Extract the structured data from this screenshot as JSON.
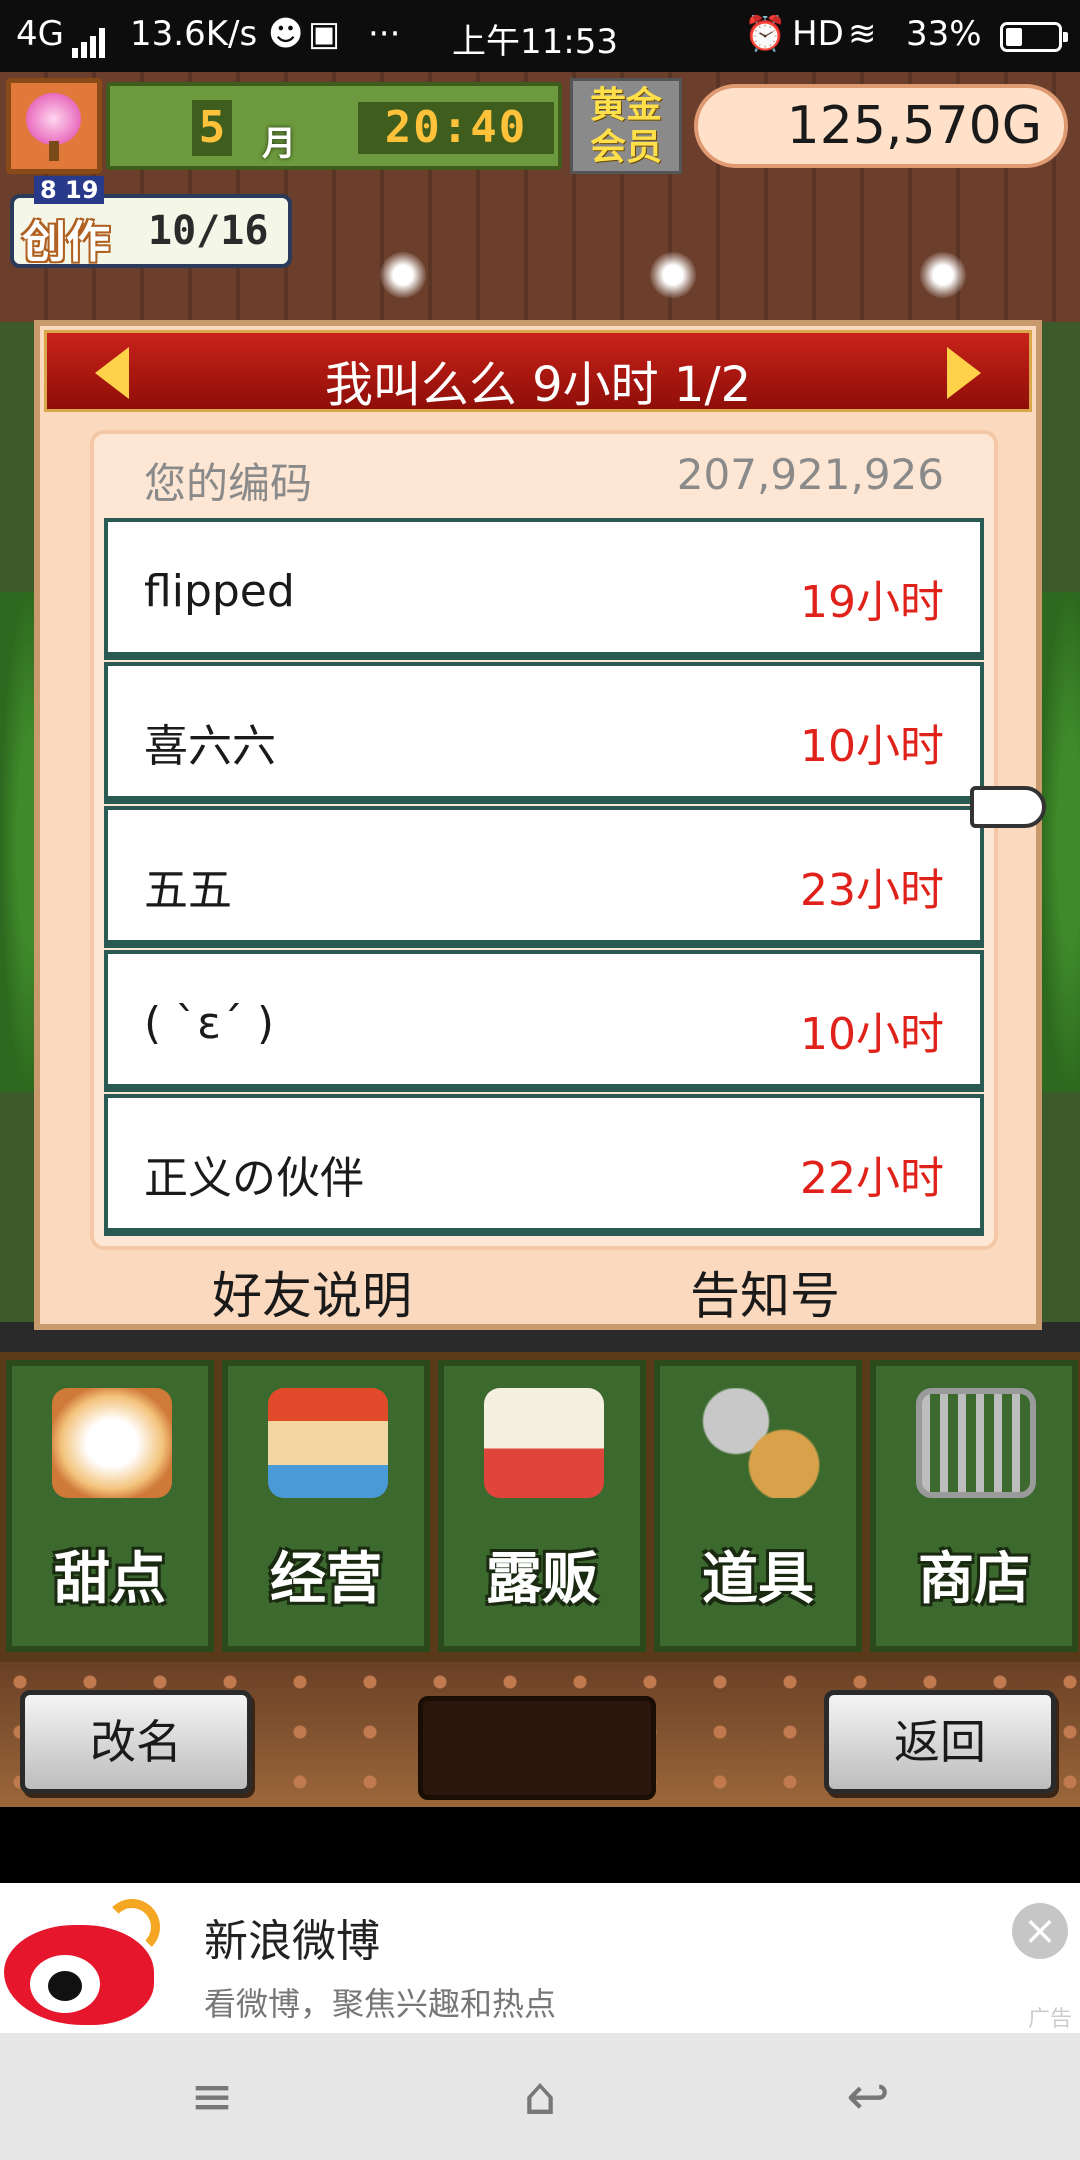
{
  "status": {
    "network": "4G",
    "speed": "13.6K/s",
    "more": "···",
    "time": "上午11:53",
    "hd": "HD",
    "battery": "33%"
  },
  "hud": {
    "month": "5",
    "month_label": "月",
    "clock": "20:40",
    "gold_badge": "黄金会员",
    "money": "125,570G",
    "create_label": "创作",
    "create_count": "10/16",
    "create_small": "8  19"
  },
  "dialog": {
    "title": "我叫么么  9小时 1/2",
    "code_label": "您的编码",
    "code_value": "207,921,926",
    "friends": [
      {
        "name": "flipped",
        "hours": "19小时"
      },
      {
        "name": "喜六六",
        "hours": "10小时"
      },
      {
        "name": "五五",
        "hours": "23小时"
      },
      {
        "name": "( ˋɛˊ )",
        "hours": "10小时"
      },
      {
        "name": "正义の伙伴",
        "hours": "22小时"
      }
    ],
    "footer_left": "好友说明",
    "footer_right": "告知号"
  },
  "menu": {
    "items": [
      {
        "label": "甜点",
        "icon": "cake-icon"
      },
      {
        "label": "经营",
        "icon": "shop-icon"
      },
      {
        "label": "露贩",
        "icon": "food-truck-icon"
      },
      {
        "label": "道具",
        "icon": "items-bag-icon"
      },
      {
        "label": "商店",
        "icon": "cart-icon"
      }
    ]
  },
  "bottom": {
    "rename": "改名",
    "back": "返回"
  },
  "ad": {
    "title": "新浪微博",
    "subtitle": "看微博，聚焦兴趣和热点",
    "tag": "广告",
    "close": "×"
  },
  "nav": {
    "menu": "≡",
    "home": "⌂",
    "back": "↩"
  },
  "colors": {
    "header_red": "#c8231a",
    "hours_red": "#e0221a",
    "panel": "#fbd9bf",
    "menu_green": "#3c6a2e"
  }
}
